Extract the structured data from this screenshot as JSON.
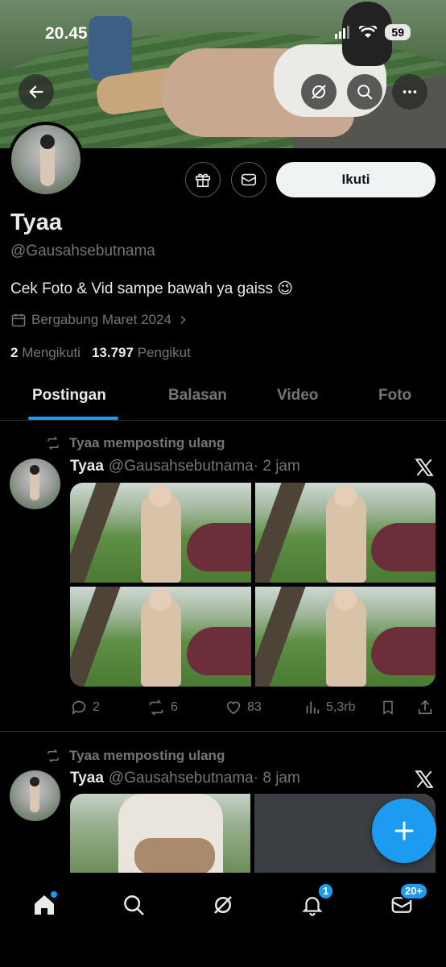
{
  "status_bar": {
    "time": "20.45",
    "battery": "59"
  },
  "header": {
    "back_icon": "arrow-left-icon",
    "grok_icon": "slash-circle-icon",
    "search_icon": "search-icon",
    "more_icon": "more-horizontal-icon"
  },
  "profile": {
    "name": "Tyaa",
    "handle": "@Gausahsebutnama",
    "bio": "Cek Foto & Vid sampe bawah ya gaiss 😉",
    "joined": "Bergabung Maret 2024",
    "following_count": "2",
    "following_label": "Mengikuti",
    "followers_count": "13.797",
    "followers_label": "Pengikut",
    "follow_button": "Ikuti"
  },
  "tabs": [
    {
      "label": "Postingan",
      "active": true
    },
    {
      "label": "Balasan",
      "active": false
    },
    {
      "label": "Video",
      "active": false
    },
    {
      "label": "Foto",
      "active": false
    }
  ],
  "posts": [
    {
      "repost_text": "Tyaa memposting ulang",
      "author_name": "Tyaa",
      "author_handle": "@Gausahsebutnama",
      "time": "· 2 jam",
      "replies": "2",
      "reposts": "6",
      "likes": "83",
      "views": "5,3rb"
    },
    {
      "repost_text": "Tyaa memposting ulang",
      "author_name": "Tyaa",
      "author_handle": "@Gausahsebutnama",
      "time": "· 8 jam"
    }
  ],
  "bottom_nav": {
    "notifications_badge": "1",
    "messages_badge": "20+"
  },
  "colors": {
    "accent": "#1d9bf0",
    "background": "#000000",
    "muted": "#71767b"
  }
}
